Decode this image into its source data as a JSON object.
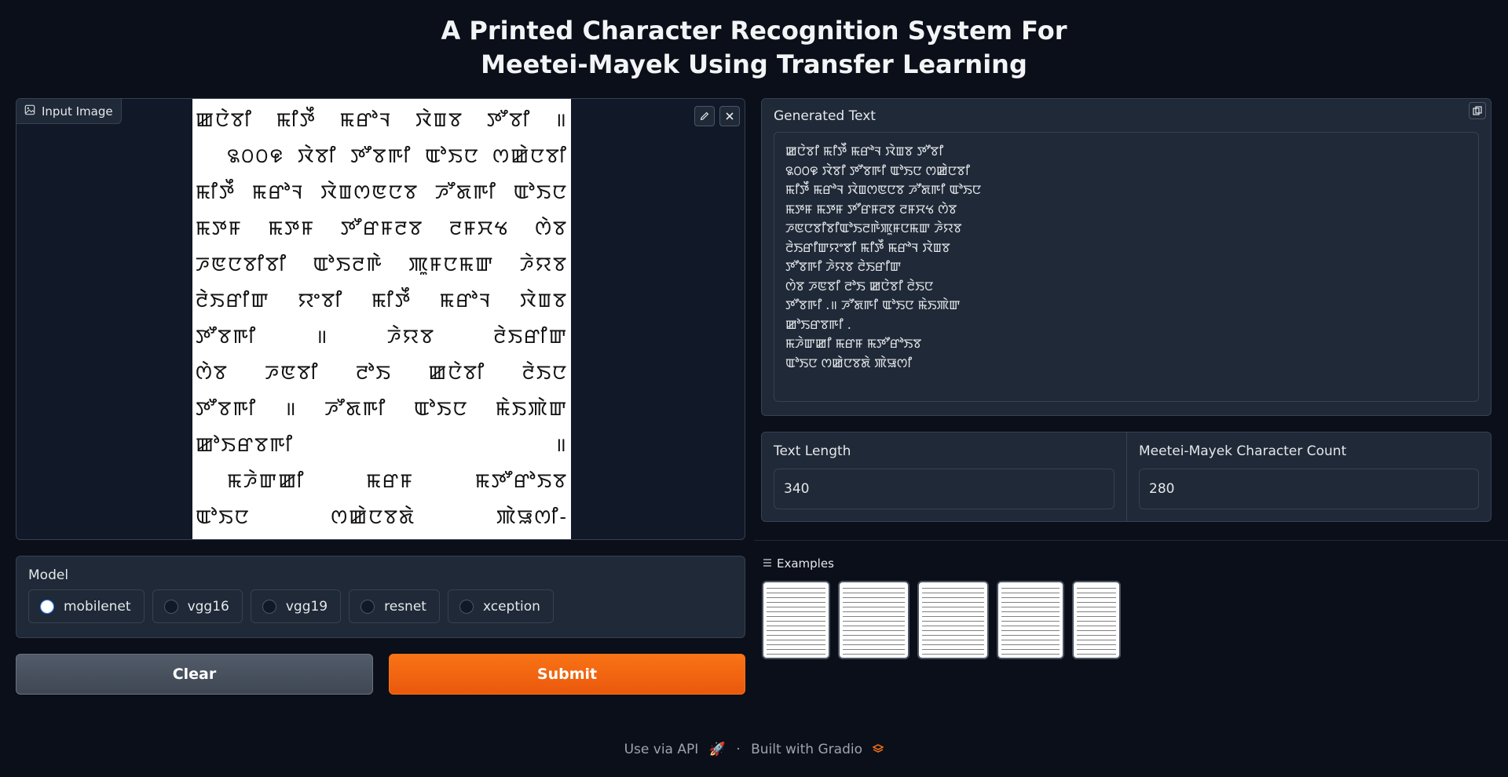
{
  "title": {
    "line1": "A Printed Character Recognition System For",
    "line2": "Meetei-Mayek Using Transfer Learning"
  },
  "input_image": {
    "label": "Input Image",
    "icon": "image-icon",
    "tools": [
      "edit-icon",
      "close-icon"
    ],
    "lines": [
      "ꯀꯅꯥꯕꯤ ꯃꯤꯇꯩ ꯃꯔꯣꯜ ꯋꯥꯡꯕ ꯇꯧꯕꯤ ॥",
      "꯲꯰꯰꯶ ꯋꯥꯕꯤ ꯇꯧꯕꯒꯤ ꯑꯣꯏꯅ ꯁꯀꯥꯅꯕꯤ",
      "ꯃꯤꯇꯩ ꯃꯔꯣꯜ ꯋꯥꯡꯁꯟꯅꯕ ꯍꯧꯗꯒꯤ ꯑꯣꯏꯅ",
      "ꯃꯇꯝ ꯃꯇꯝ ꯇꯧꯔꯝꯂꯕ ꯂꯝꯆꯠ ꯁꯥꯕ",
      "ꯍꯟꯅꯕꯤꯕꯤ ꯑꯣꯏꯂꯒꯥ ꯄꯨꯝꯅꯃꯛ ꯍꯥꯌꯕ",
      "ꯂꯥꯏꯔꯤꯛ ꯌꯦꯕꯤ ꯃꯤꯇꯩ ꯃꯔꯣꯜ ꯋꯥꯡꯕ",
      "ꯇꯧꯕꯒꯤ ॥ ꯍꯥꯌꯕ ꯂꯥꯏꯔꯤꯛ",
      "ꯁꯥꯕ ꯍꯟꯕꯤ ꯂꯣꯏ ꯀꯅꯥꯕꯤ ꯂꯥꯏꯅ",
      "ꯇꯧꯕꯒꯤ ॥ ꯍꯧꯗꯒꯤ ꯑꯣꯏꯅ ꯃꯥꯏꯄꯥꯛ",
      "ꯀꯣꯏꯔꯕꯒꯤ ॥",
      "ꯃꯍꯥꯛꯀꯤ ꯃꯔꯝ ꯃꯇꯧꯔꯣꯏꯕ",
      "ꯑꯣꯏꯅ ꯁꯀꯥꯅꯕꯗꯥ ꯄꯥꯎꯁꯤ-"
    ]
  },
  "generated_text": {
    "label": "Generated Text",
    "copy_icon": "copy-icon",
    "lines": [
      "ꯀꯅꯥꯕꯤ ꯃꯤꯇꯩ ꯃꯔꯣꯜ ꯋꯥꯡꯕ ꯇꯧꯕꯤ",
      "꯲꯰꯰꯶ ꯋꯥꯕꯤ ꯇꯧꯕꯒꯤ ꯑꯣꯏꯅ ꯁꯀꯥꯅꯕꯤ",
      "ꯃꯤꯇꯩ ꯃꯔꯣꯜ ꯋꯥꯡꯁꯟꯅꯕ ꯍꯧꯗꯒꯤ ꯑꯣꯏꯅ",
      "ꯃꯇꯝ ꯃꯇꯝ ꯇꯧꯔꯝꯂꯕ ꯂꯝꯆꯠ ꯁꯥꯕ",
      "ꯍꯟꯅꯕꯤꯕꯤꯑꯣꯏꯂꯒꯥꯄꯨꯝꯅꯃꯛ ꯍꯥꯌꯕ",
      "ꯂꯥꯏꯔꯤꯛꯌꯦꯕꯤ ꯃꯤꯇꯩ ꯃꯔꯣꯜ ꯋꯥꯡꯕ",
      "ꯇꯧꯕꯒꯤ ꯍꯥꯌꯕ ꯂꯥꯏꯔꯤꯛ",
      "ꯁꯥꯕ ꯍꯟꯕꯤ ꯂꯣꯏ ꯀꯅꯥꯕꯤ ꯂꯥꯏꯅ",
      "ꯇꯧꯕꯒꯤ .॥ ꯍꯧꯗꯒꯤ ꯑꯣꯏꯅ ꯃꯥꯏꯄꯥꯛ",
      "ꯀꯣꯏꯔꯕꯒꯤ .",
      "ꯃꯍꯥꯛꯀꯤ ꯃꯔꯝ ꯃꯇꯧꯔꯣꯏꯕ",
      "ꯑꯣꯏꯅ ꯁꯀꯥꯅꯕꯗꯥ ꯄꯥꯎꯁꯤ"
    ]
  },
  "stats": {
    "text_length_label": "Text Length",
    "text_length_value": "340",
    "char_count_label": "Meetei-Mayek Character Count",
    "char_count_value": "280"
  },
  "model": {
    "label": "Model",
    "options": [
      "mobilenet",
      "vgg16",
      "vgg19",
      "resnet",
      "xception"
    ],
    "selected": "mobilenet"
  },
  "buttons": {
    "clear": "Clear",
    "submit": "Submit"
  },
  "examples": {
    "label": "Examples",
    "icon": "list-icon",
    "count": 5
  },
  "footer": {
    "api": "Use via API",
    "separator": "·",
    "built": "Built with Gradio"
  },
  "colors": {
    "background": "#0b0f19",
    "panel": "#1f2937",
    "accent_orange": "#f97316",
    "radio_blue": "#2563eb"
  }
}
